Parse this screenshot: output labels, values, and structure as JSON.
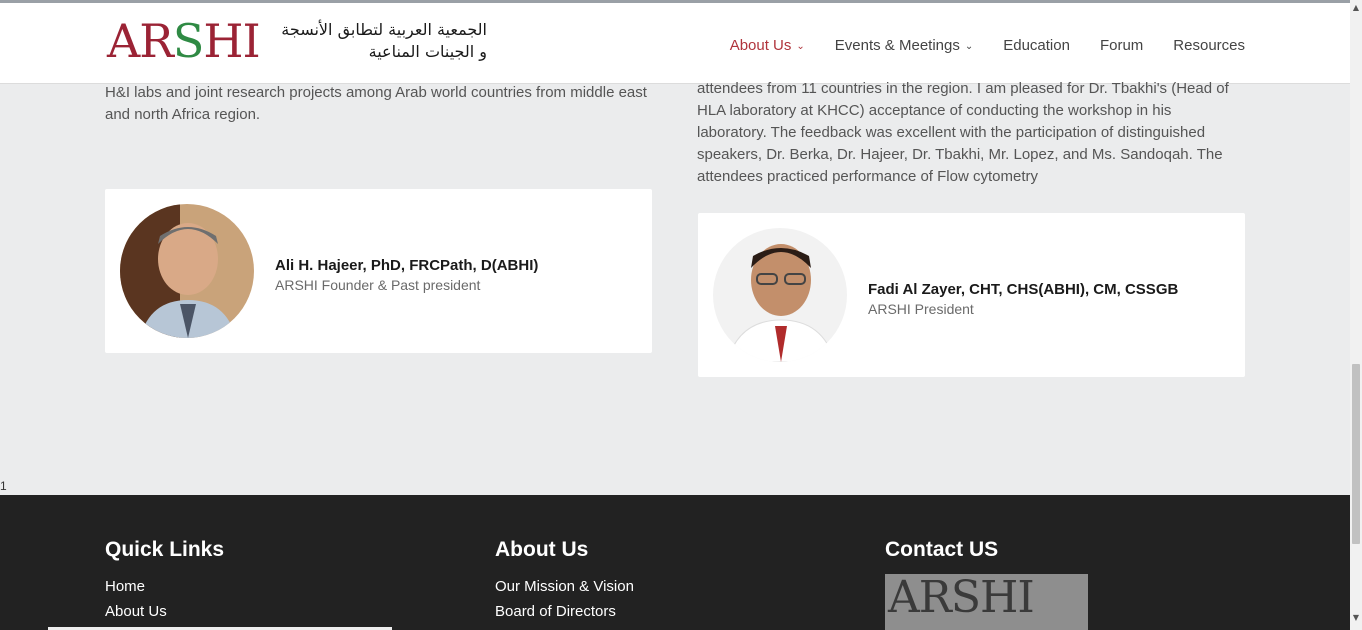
{
  "logo": {
    "latin_a": "AR",
    "latin_s": "S",
    "latin_h": "HI",
    "arabic_line1": "الجمعية العربية لتطابق الأنسجة",
    "arabic_line2": "و الجينات المناعية"
  },
  "nav": {
    "items": [
      {
        "label": "About Us",
        "active": true,
        "dropdown": true
      },
      {
        "label": "Events & Meetings",
        "active": false,
        "dropdown": true
      },
      {
        "label": "Education",
        "active": false,
        "dropdown": false
      },
      {
        "label": "Forum",
        "active": false,
        "dropdown": false
      },
      {
        "label": "Resources",
        "active": false,
        "dropdown": false
      }
    ]
  },
  "content": {
    "left_text": "H&I labs and joint research projects among Arab world countries from middle east and north Africa region.",
    "right_text": "attendees from 11 countries in the region. I am pleased for Dr. Tbakhi's (Head of HLA laboratory at KHCC) acceptance of conducting the workshop in his laboratory. The feedback was excellent with the participation of distinguished speakers, Dr. Berka, Dr. Hajeer, Dr. Tbakhi, Mr. Lopez, and Ms. Sandoqah. The attendees practiced performance of Flow cytometry",
    "people": [
      {
        "name": "Ali H. Hajeer, PhD, FRCPath, D(ABHI)",
        "role": "ARSHI Founder & Past president"
      },
      {
        "name": "Fadi Al Zayer, CHT, CHS(ABHI), CM, CSSGB",
        "role": "ARSHI President"
      }
    ],
    "stray_char": "1"
  },
  "footer": {
    "quick_links": {
      "title": "Quick Links",
      "links": [
        "Home",
        "About Us"
      ]
    },
    "about_us": {
      "title": "About Us",
      "links": [
        "Our Mission & Vision",
        "Board of Directors"
      ]
    },
    "contact": {
      "title": "Contact US",
      "logo_text": "ARSHI"
    }
  },
  "colors": {
    "accent": "#b0343c",
    "footer_bg": "#222222",
    "page_bg": "#ebeced"
  },
  "icons": {
    "dropdown": "chevron-down-icon",
    "scroll_up": "arrow-up-icon",
    "scroll_down": "arrow-down-icon"
  }
}
